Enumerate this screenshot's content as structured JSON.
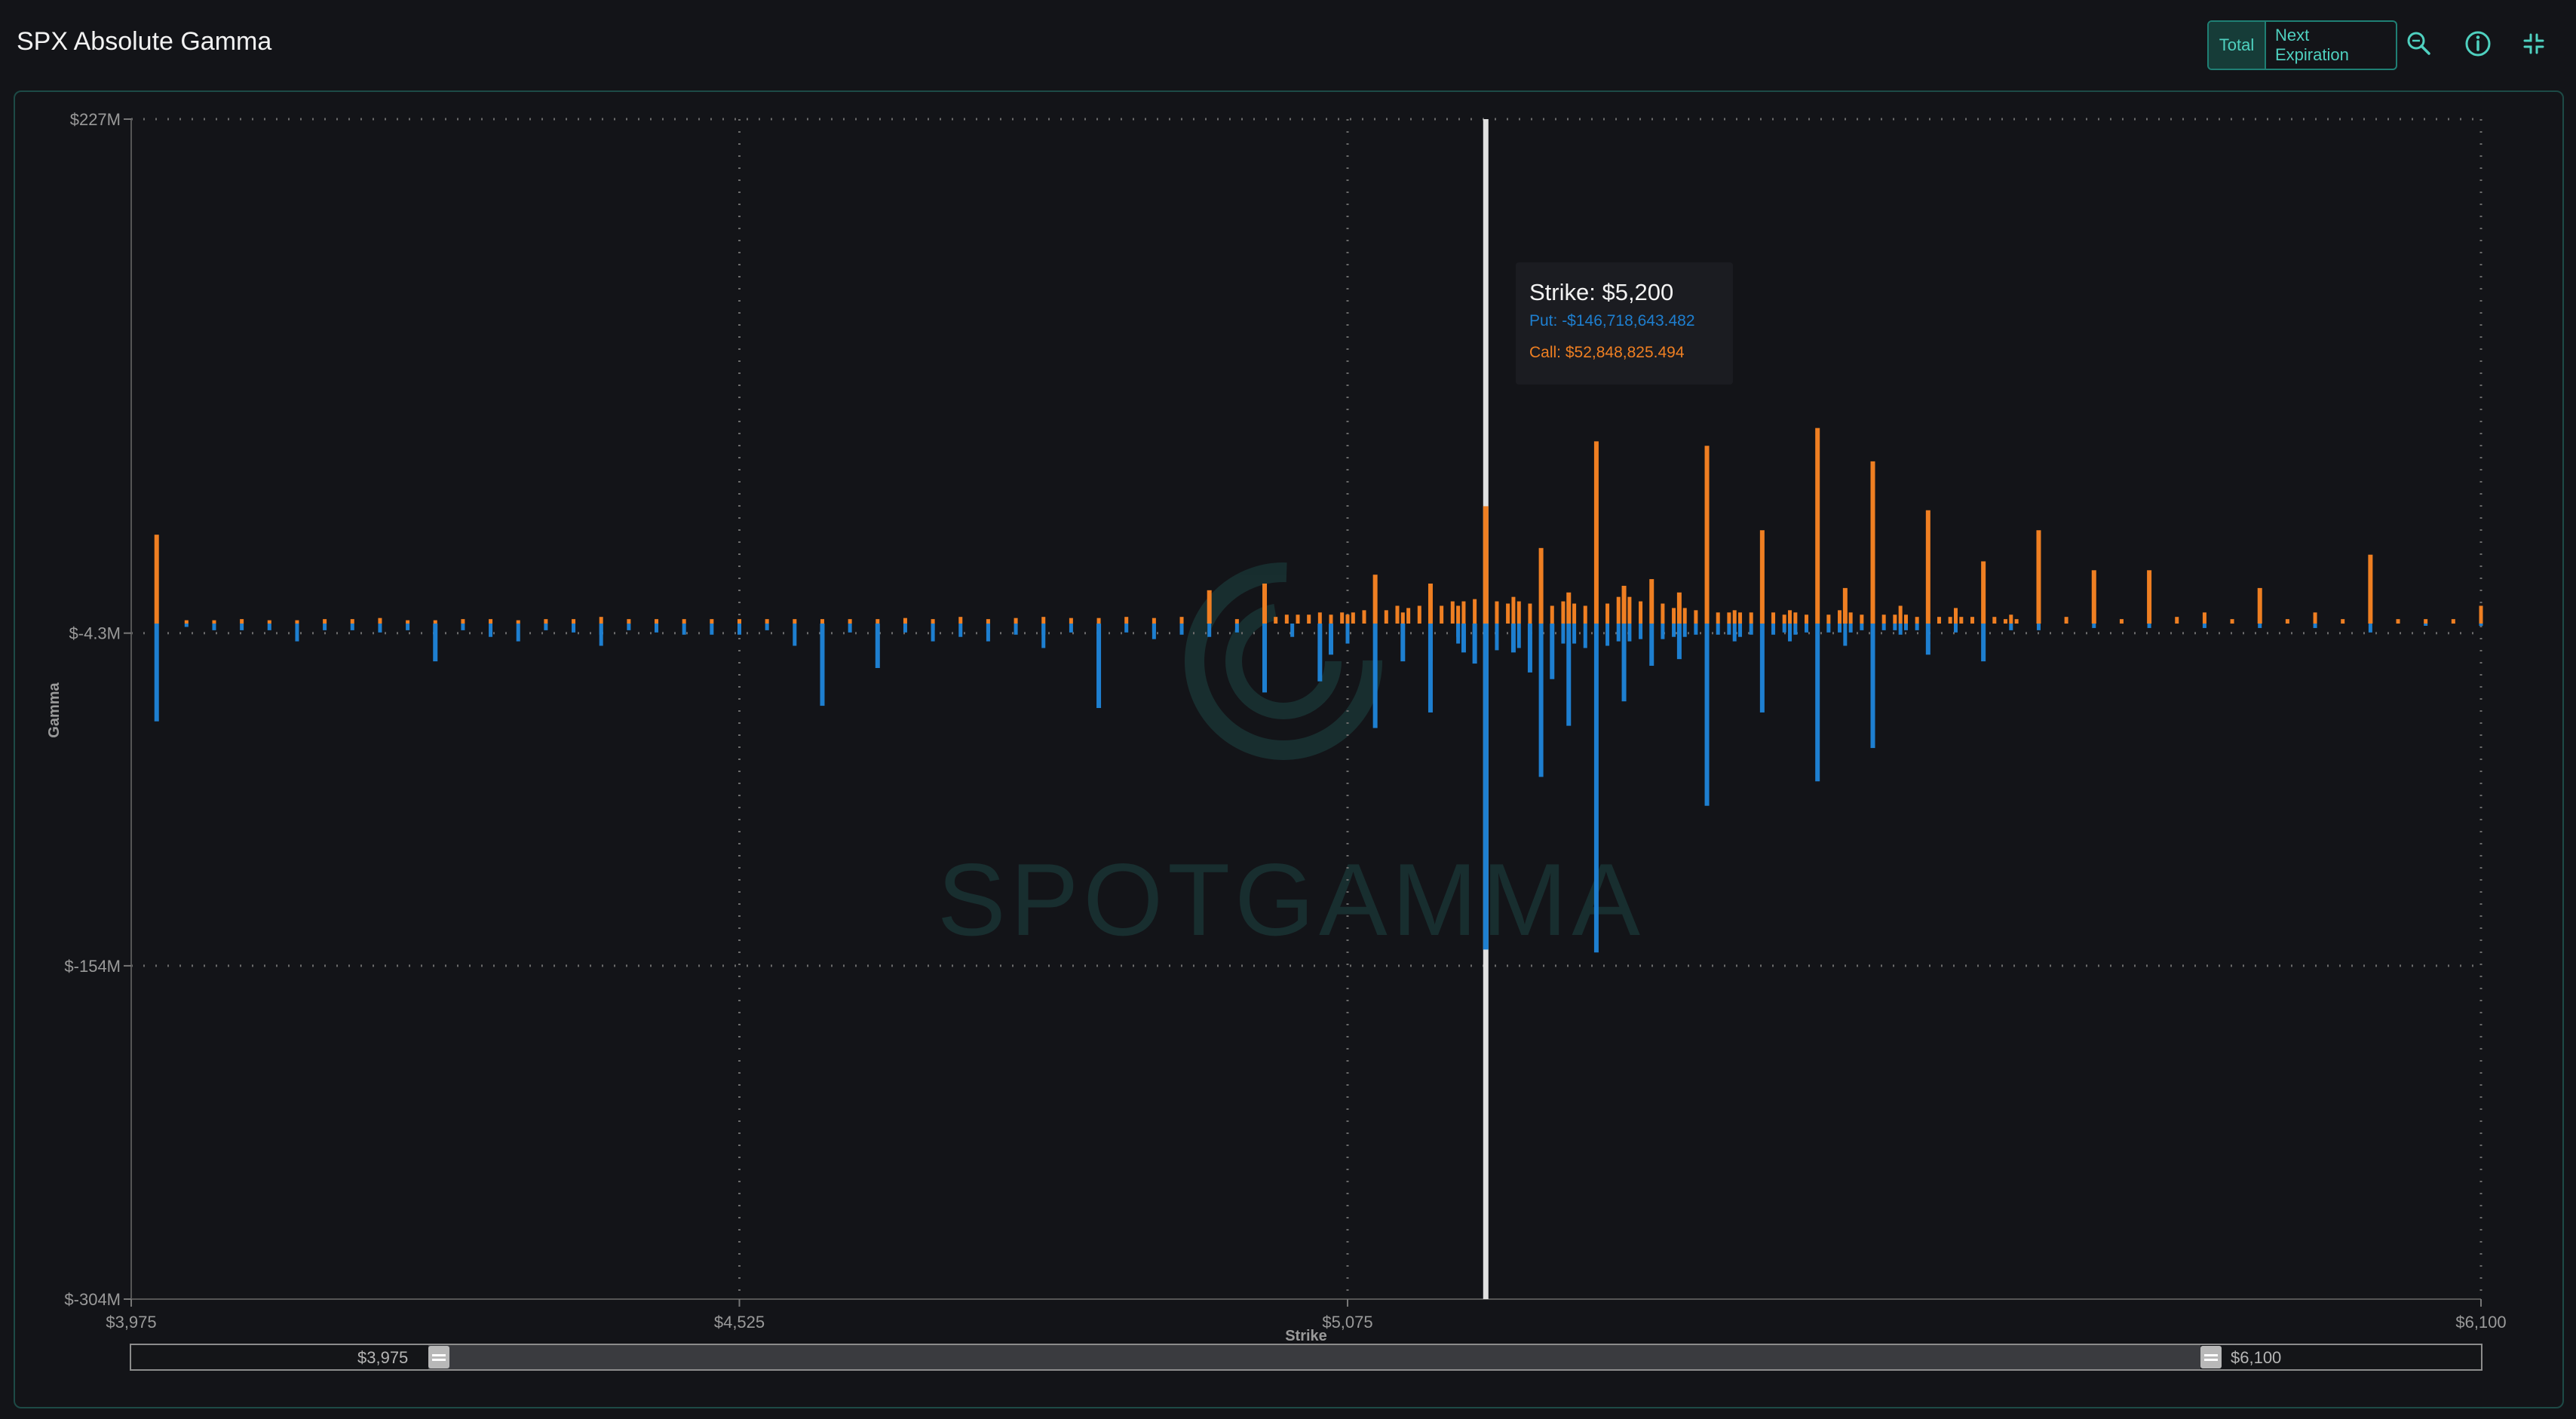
{
  "header": {
    "title": "SPX Absolute Gamma",
    "toggle": {
      "total_label": "Total",
      "next_label": "Next Expiration",
      "selected": "Total"
    },
    "icons": [
      "search-zoom-icon",
      "info-icon",
      "collapse-icon"
    ]
  },
  "colors": {
    "put": "#1e7fd0",
    "call": "#ef7f22",
    "accent": "#4fd1c0",
    "background": "#131418",
    "cursor": "#e0e0e0"
  },
  "watermark": "SPOTGAMMA",
  "tooltip": {
    "title": "Strike: $5,200",
    "put": "Put: -$146,718,643.482",
    "call": "Call: $52,848,825.494"
  },
  "slider": {
    "min_label": "$3,975",
    "max_label": "$6,100"
  },
  "chart_data": {
    "type": "bar",
    "xlabel": "Strike",
    "ylabel": "Gamma",
    "xlim": [
      3975,
      6100
    ],
    "ylim": [
      -304,
      227
    ],
    "y_unit": "$M",
    "y_ticks": [
      "$227M",
      "$-4.3M",
      "$-154M",
      "$-304M"
    ],
    "y_tick_values": [
      227,
      -4.3,
      -154,
      -304
    ],
    "x_ticks": [
      "$3,975",
      "$4,525",
      "$5,075",
      "$6,100"
    ],
    "x_tick_values": [
      3975,
      4525,
      5075,
      6100
    ],
    "grid": true,
    "legend": "none",
    "cursor_strike": 5200,
    "series": [
      {
        "name": "Call",
        "color": "#ef7f22",
        "points": [
          [
            3998,
            40
          ],
          [
            4025,
            1.5
          ],
          [
            4050,
            1.5
          ],
          [
            4075,
            2
          ],
          [
            4100,
            1.5
          ],
          [
            4125,
            1.5
          ],
          [
            4150,
            2
          ],
          [
            4175,
            2
          ],
          [
            4200,
            2.5
          ],
          [
            4225,
            1.5
          ],
          [
            4250,
            1.5
          ],
          [
            4275,
            2
          ],
          [
            4300,
            2
          ],
          [
            4325,
            1.5
          ],
          [
            4350,
            2
          ],
          [
            4375,
            2
          ],
          [
            4400,
            3
          ],
          [
            4425,
            2
          ],
          [
            4450,
            2
          ],
          [
            4475,
            2
          ],
          [
            4500,
            2
          ],
          [
            4525,
            2
          ],
          [
            4550,
            2
          ],
          [
            4575,
            2
          ],
          [
            4600,
            2
          ],
          [
            4625,
            2
          ],
          [
            4650,
            2
          ],
          [
            4675,
            2.5
          ],
          [
            4700,
            2
          ],
          [
            4725,
            3
          ],
          [
            4750,
            2
          ],
          [
            4775,
            2.5
          ],
          [
            4800,
            3
          ],
          [
            4825,
            2.5
          ],
          [
            4850,
            2.5
          ],
          [
            4875,
            3
          ],
          [
            4900,
            2.5
          ],
          [
            4925,
            3
          ],
          [
            4950,
            15
          ],
          [
            4975,
            2
          ],
          [
            5000,
            18
          ],
          [
            5010,
            3
          ],
          [
            5020,
            4
          ],
          [
            5030,
            4
          ],
          [
            5040,
            4
          ],
          [
            5050,
            5
          ],
          [
            5060,
            4
          ],
          [
            5070,
            5
          ],
          [
            5075,
            4
          ],
          [
            5080,
            5
          ],
          [
            5090,
            6
          ],
          [
            5100,
            22
          ],
          [
            5110,
            6
          ],
          [
            5120,
            8
          ],
          [
            5125,
            5
          ],
          [
            5130,
            7
          ],
          [
            5140,
            8
          ],
          [
            5150,
            18
          ],
          [
            5160,
            8
          ],
          [
            5170,
            10
          ],
          [
            5175,
            8
          ],
          [
            5180,
            10
          ],
          [
            5190,
            11
          ],
          [
            5200,
            52.8
          ],
          [
            5210,
            10
          ],
          [
            5220,
            9
          ],
          [
            5225,
            12
          ],
          [
            5230,
            10
          ],
          [
            5240,
            9
          ],
          [
            5250,
            34
          ],
          [
            5260,
            8
          ],
          [
            5270,
            10
          ],
          [
            5275,
            14
          ],
          [
            5280,
            9
          ],
          [
            5290,
            8
          ],
          [
            5300,
            82
          ],
          [
            5310,
            9
          ],
          [
            5320,
            12
          ],
          [
            5325,
            17
          ],
          [
            5330,
            12
          ],
          [
            5340,
            10
          ],
          [
            5350,
            20
          ],
          [
            5360,
            9
          ],
          [
            5370,
            7
          ],
          [
            5375,
            14
          ],
          [
            5380,
            7
          ],
          [
            5390,
            6
          ],
          [
            5400,
            80
          ],
          [
            5410,
            5
          ],
          [
            5420,
            5
          ],
          [
            5425,
            6
          ],
          [
            5430,
            5
          ],
          [
            5440,
            5
          ],
          [
            5450,
            42
          ],
          [
            5460,
            5
          ],
          [
            5470,
            4
          ],
          [
            5475,
            6
          ],
          [
            5480,
            5
          ],
          [
            5490,
            4
          ],
          [
            5500,
            88
          ],
          [
            5510,
            4
          ],
          [
            5520,
            6
          ],
          [
            5525,
            16
          ],
          [
            5530,
            5
          ],
          [
            5540,
            4
          ],
          [
            5550,
            73
          ],
          [
            5560,
            4
          ],
          [
            5570,
            4
          ],
          [
            5575,
            8
          ],
          [
            5580,
            4
          ],
          [
            5590,
            3
          ],
          [
            5600,
            51
          ],
          [
            5610,
            3
          ],
          [
            5620,
            3
          ],
          [
            5625,
            7
          ],
          [
            5630,
            3
          ],
          [
            5640,
            3
          ],
          [
            5650,
            28
          ],
          [
            5660,
            3
          ],
          [
            5670,
            2
          ],
          [
            5675,
            4
          ],
          [
            5680,
            2
          ],
          [
            5700,
            42
          ],
          [
            5725,
            3
          ],
          [
            5750,
            24
          ],
          [
            5775,
            2
          ],
          [
            5800,
            24
          ],
          [
            5825,
            3
          ],
          [
            5850,
            5
          ],
          [
            5875,
            2
          ],
          [
            5900,
            16
          ],
          [
            5925,
            2
          ],
          [
            5950,
            5
          ],
          [
            5975,
            2
          ],
          [
            6000,
            31
          ],
          [
            6025,
            2
          ],
          [
            6050,
            2
          ],
          [
            6075,
            2
          ],
          [
            6100,
            8
          ]
        ]
      },
      {
        "name": "Put",
        "color": "#1e7fd0",
        "points": [
          [
            3998,
            -44
          ],
          [
            4025,
            -1.5
          ],
          [
            4050,
            -3
          ],
          [
            4075,
            -3
          ],
          [
            4100,
            -3
          ],
          [
            4125,
            -8
          ],
          [
            4150,
            -3
          ],
          [
            4175,
            -3
          ],
          [
            4200,
            -4
          ],
          [
            4225,
            -3
          ],
          [
            4250,
            -17
          ],
          [
            4275,
            -3
          ],
          [
            4300,
            -6
          ],
          [
            4325,
            -8
          ],
          [
            4350,
            -3
          ],
          [
            4375,
            -4
          ],
          [
            4400,
            -10
          ],
          [
            4425,
            -3
          ],
          [
            4450,
            -4
          ],
          [
            4475,
            -5
          ],
          [
            4500,
            -5
          ],
          [
            4525,
            -5
          ],
          [
            4550,
            -3
          ],
          [
            4575,
            -10
          ],
          [
            4600,
            -5
          ],
          [
            4625,
            -4
          ],
          [
            4650,
            -20
          ],
          [
            4675,
            -4
          ],
          [
            4700,
            -3
          ],
          [
            4725,
            -6
          ],
          [
            4750,
            -4
          ],
          [
            4775,
            -5
          ],
          [
            4800,
            -5
          ],
          [
            4825,
            -4
          ],
          [
            4850,
            -38
          ],
          [
            4875,
            -4
          ],
          [
            4900,
            -4
          ],
          [
            4925,
            -5
          ],
          [
            4950,
            -6
          ],
          [
            4975,
            -4
          ],
          [
            5000,
            -4
          ],
          [
            5025,
            -6
          ],
          [
            5050,
            -26
          ],
          [
            5075,
            -5
          ],
          [
            5100,
            -47
          ],
          [
            5125,
            -5
          ],
          [
            5150,
            -40
          ],
          [
            5175,
            -6
          ],
          [
            5200,
            -146.7
          ],
          [
            4400,
            -5
          ],
          [
            4600,
            -37
          ],
          [
            4700,
            -8
          ],
          [
            4750,
            -8
          ],
          [
            4800,
            -11
          ],
          [
            4900,
            -7
          ],
          [
            5000,
            -31
          ],
          [
            5050,
            -10
          ],
          [
            5060,
            -14
          ],
          [
            5075,
            -9
          ],
          [
            5125,
            -17
          ],
          [
            5150,
            -17
          ],
          [
            5175,
            -9
          ],
          [
            5180,
            -13
          ],
          [
            5190,
            -18
          ],
          [
            5210,
            -12
          ],
          [
            5225,
            -13
          ],
          [
            5230,
            -11
          ],
          [
            5240,
            -22
          ],
          [
            5250,
            -69
          ],
          [
            5260,
            -25
          ],
          [
            5270,
            -9
          ],
          [
            5275,
            -46
          ],
          [
            5280,
            -9
          ],
          [
            5290,
            -11
          ],
          [
            5300,
            -148
          ],
          [
            5310,
            -10
          ],
          [
            5320,
            -8
          ],
          [
            5325,
            -35
          ],
          [
            5330,
            -8
          ],
          [
            5340,
            -7
          ],
          [
            5350,
            -19
          ],
          [
            5360,
            -7
          ],
          [
            5370,
            -6
          ],
          [
            5375,
            -16
          ],
          [
            5380,
            -6
          ],
          [
            5390,
            -5
          ],
          [
            5400,
            -82
          ],
          [
            5410,
            -5
          ],
          [
            5420,
            -5
          ],
          [
            5425,
            -8
          ],
          [
            5430,
            -6
          ],
          [
            5440,
            -5
          ],
          [
            5450,
            -40
          ],
          [
            5460,
            -5
          ],
          [
            5470,
            -4
          ],
          [
            5475,
            -8
          ],
          [
            5480,
            -5
          ],
          [
            5490,
            -4
          ],
          [
            5500,
            -71
          ],
          [
            5510,
            -4
          ],
          [
            5520,
            -4
          ],
          [
            5525,
            -10
          ],
          [
            5530,
            -4
          ],
          [
            5540,
            -3
          ],
          [
            5550,
            -56
          ],
          [
            5560,
            -3
          ],
          [
            5570,
            -3
          ],
          [
            5575,
            -5
          ],
          [
            5580,
            -3
          ],
          [
            5590,
            -3
          ],
          [
            5600,
            -14
          ],
          [
            5625,
            -4
          ],
          [
            5650,
            -17
          ],
          [
            5675,
            -3
          ],
          [
            5700,
            -3
          ],
          [
            5750,
            -2
          ],
          [
            5800,
            -2
          ],
          [
            5850,
            -2
          ],
          [
            5900,
            -2
          ],
          [
            5950,
            -2
          ],
          [
            6000,
            -4
          ],
          [
            6050,
            -1
          ],
          [
            6100,
            -1
          ]
        ]
      }
    ]
  }
}
